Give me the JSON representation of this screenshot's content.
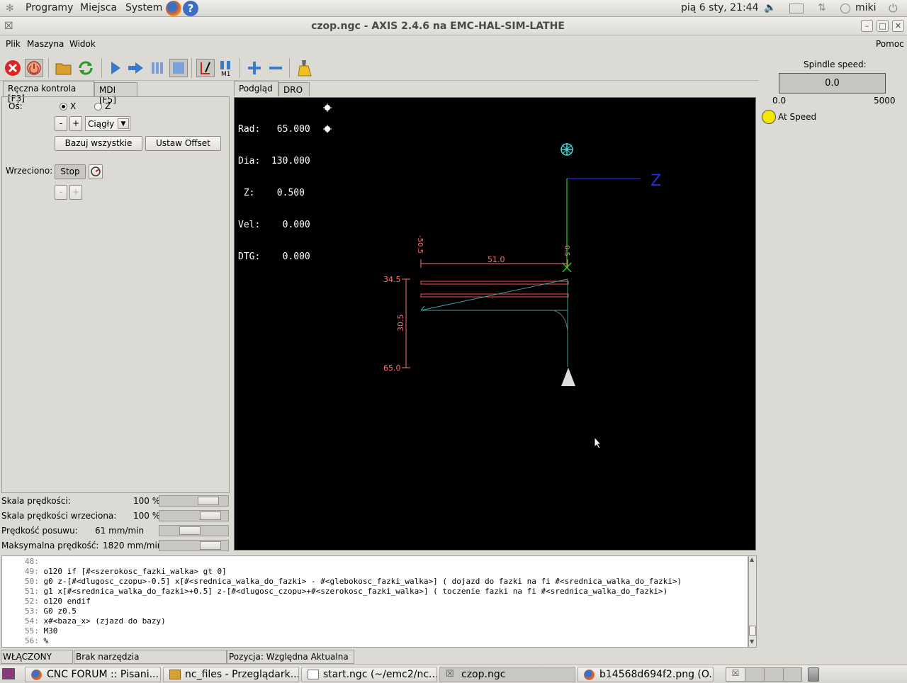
{
  "top_panel": {
    "menus": [
      "Programy",
      "Miejsca",
      "System"
    ],
    "clock": "pią  6 sty, 21:44",
    "user": "miki"
  },
  "window": {
    "title": "czop.ngc - AXIS 2.4.6 na EMC-HAL-SIM-LATHE"
  },
  "menubar": {
    "items": [
      "Plik",
      "Maszyna",
      "Widok"
    ],
    "help": "Pomoc"
  },
  "left_tabs": [
    "Ręczna kontrola [F3]",
    "MDI [F5]"
  ],
  "manual": {
    "axis_label": "Oś:",
    "axis_x": "X",
    "axis_z": "Z",
    "minus": "-",
    "plus": "+",
    "jog_mode": "Ciągły",
    "home_all": "Bazuj wszystkie",
    "touch_off": "Ustaw Offset",
    "spindle_label": "Wrzeciono:",
    "spindle_stop": "Stop",
    "spindle_minus": "-",
    "spindle_plus": "+"
  },
  "sliders": [
    {
      "label": "Skala prędkości:",
      "value": "100 %",
      "fraction": 0.8
    },
    {
      "label": "Skala prędkości wrzeciona:",
      "value": "100 %",
      "fraction": 0.85
    },
    {
      "label": "Prędkość posuwu:",
      "value": "61 mm/min",
      "fraction": 0.42
    },
    {
      "label": "Maksymalna prędkość:",
      "value": "1820 mm/min",
      "fraction": 0.85
    }
  ],
  "preview_tabs": [
    "Podgląd",
    "DRO"
  ],
  "dro": {
    "rad": "Rad:   65.000",
    "dia": "Dia:  130.000",
    "z": " Z:    0.500",
    "vel": "Vel:    0.000",
    "dtg": "DTG:    0.000"
  },
  "plot": {
    "axis_label": "Z",
    "dim_top": "-50.5",
    "dim_len": "51.0",
    "dim_top_right": "0.5",
    "dim_r_top": "34.5",
    "dim_r_mid": "30.5",
    "dim_r_bot": "65.0"
  },
  "spindle": {
    "label": "Spindle speed:",
    "value": "0.0",
    "min": "0.0",
    "max": "5000",
    "at_speed": "At Speed"
  },
  "code": [
    {
      "n": "48:",
      "t": ""
    },
    {
      "n": "49:",
      "t": "o120 if [#<szerokosc_fazki_walka> gt 0]"
    },
    {
      "n": "50:",
      "t": "g0 z-[#<dlugosc_czopu>-0.5] x[#<srednica_walka_do_fazki> - #<glebokosc_fazki_walka>] ( dojazd do fazki na fi #<srednica_walka_do_fazki>)"
    },
    {
      "n": "51:",
      "t": "g1 x[#<srednica_walka_do_fazki>+0.5] z-[#<dlugosc_czopu>+#<szerokosc_fazki_walka>] ( toczenie fazki na fi #<srednica_walka_do_fazki>)"
    },
    {
      "n": "52:",
      "t": "o120 endif"
    },
    {
      "n": "53:",
      "t": "G0 z0.5"
    },
    {
      "n": "54:",
      "t": "x#<baza_x> (zjazd do bazy)"
    },
    {
      "n": "55:",
      "t": "M30"
    },
    {
      "n": "56:",
      "t": "%"
    }
  ],
  "status": {
    "state": "WŁĄCZONY",
    "tool": "Brak narzędzia",
    "position": "Pozycja: Względna Aktualna"
  },
  "taskbar": [
    "CNC FORUM :: Pisani...",
    "nc_files - Przeglądark...",
    "start.ngc (~/emc2/nc...",
    "czop.ngc",
    "b14568d694f2.png (O..."
  ]
}
